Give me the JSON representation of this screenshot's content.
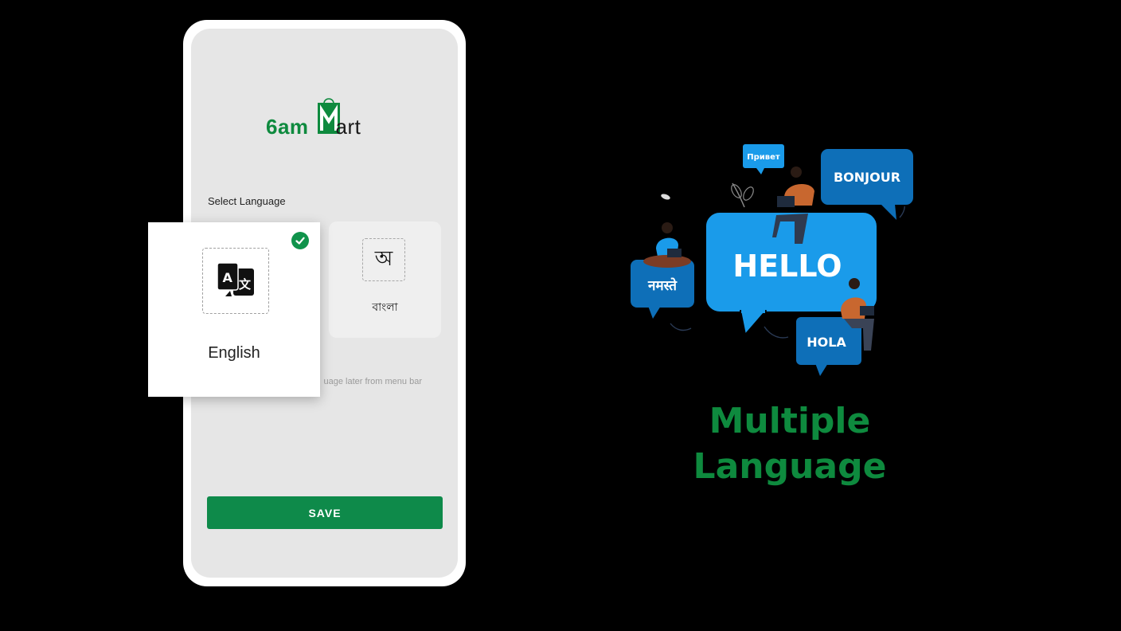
{
  "app": {
    "logo_main": "6am",
    "logo_rest": "art",
    "logo_m": "M"
  },
  "screen": {
    "select_language_label": "Select Language",
    "hint_text": "uage later from menu bar",
    "save_label": "SAVE"
  },
  "languages": [
    {
      "label": "English",
      "icon": "translate-icon",
      "selected": true
    },
    {
      "label": "বাংলা",
      "icon_glyph": "অ",
      "icon": "bangla-letter-icon",
      "selected": false
    }
  ],
  "illustration": {
    "bubbles": {
      "hello": "HELLO",
      "bonjour": "BONJOUR",
      "hola": "HOLA",
      "privet": "Привет",
      "hindi": "नमस्ते"
    }
  },
  "headline": {
    "line1": "Multiple",
    "line2": "Language"
  },
  "colors": {
    "brand_green": "#0e8a3e",
    "bubble_blue": "#1a9bea",
    "bubble_dark_blue": "#0e6fb8"
  }
}
